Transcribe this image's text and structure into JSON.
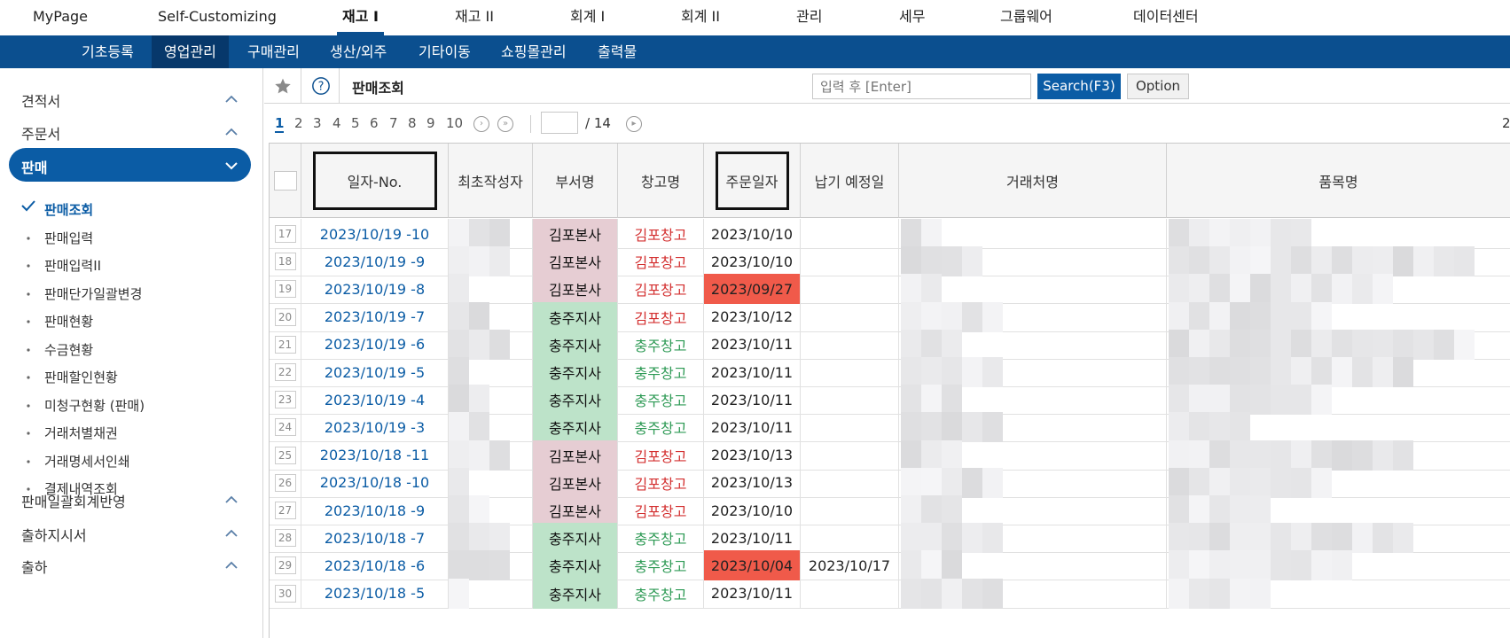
{
  "top_nav": {
    "items": [
      {
        "label": "MyPage"
      },
      {
        "label": "Self-Customizing"
      },
      {
        "label": "재고 I",
        "active": true
      },
      {
        "label": "재고 II"
      },
      {
        "label": "회계 I"
      },
      {
        "label": "회계 II"
      },
      {
        "label": "관리"
      },
      {
        "label": "세무"
      },
      {
        "label": "그룹웨어"
      },
      {
        "label": "데이터센터"
      }
    ]
  },
  "sub_nav": {
    "items": [
      {
        "label": "기초등록"
      },
      {
        "label": "영업관리",
        "active": true
      },
      {
        "label": "구매관리"
      },
      {
        "label": "생산/외주"
      },
      {
        "label": "기타이동"
      },
      {
        "label": "쇼핑몰관리"
      },
      {
        "label": "출력물"
      }
    ]
  },
  "sidebar": {
    "groups_top": [
      {
        "label": "견적서",
        "icon": "chevron-up-icon"
      },
      {
        "label": "주문서",
        "icon": "chevron-up-icon"
      },
      {
        "label": "판매",
        "icon": "chevron-down-icon",
        "active": true
      }
    ],
    "sub_items": [
      {
        "label": "판매조회",
        "active": true
      },
      {
        "label": "판매입력"
      },
      {
        "label": "판매입력II"
      },
      {
        "label": "판매단가일괄변경"
      },
      {
        "label": "판매현황"
      },
      {
        "label": "수금현황"
      },
      {
        "label": "판매할인현황"
      },
      {
        "label": "미청구현황 (판매)"
      },
      {
        "label": "거래처별채권"
      },
      {
        "label": "거래명세서인쇄"
      },
      {
        "label": "결제내역조회"
      }
    ],
    "groups_bottom": [
      {
        "label": "판매일괄회계반영",
        "icon": "chevron-up-icon"
      },
      {
        "label": "출하지시서",
        "icon": "chevron-up-icon"
      },
      {
        "label": "출하",
        "icon": "chevron-up-icon"
      }
    ]
  },
  "toolbar": {
    "page_title": "판매조회",
    "search_placeholder": "입력 후 [Enter]",
    "search_button": "Search(F3)",
    "option_button": "Option"
  },
  "pager": {
    "pages": [
      "1",
      "2",
      "3",
      "4",
      "5",
      "6",
      "7",
      "8",
      "9",
      "10"
    ],
    "current": "1",
    "total": "/ 14",
    "edge_text": "2"
  },
  "grid": {
    "columns": [
      {
        "key": "check",
        "label": ""
      },
      {
        "key": "date_no",
        "label": "일자-No.",
        "boxed": true
      },
      {
        "key": "creator",
        "label": "최초작성자"
      },
      {
        "key": "dept",
        "label": "부서명"
      },
      {
        "key": "warehouse",
        "label": "창고명"
      },
      {
        "key": "order_date",
        "label": "주문일자",
        "boxed": true
      },
      {
        "key": "due_date",
        "label": "납기 예정일"
      },
      {
        "key": "client",
        "label": "거래처명"
      },
      {
        "key": "item",
        "label": "품목명"
      }
    ],
    "rows": [
      {
        "n": "17",
        "date_no": "2023/10/19 -10",
        "dept": "김포본사",
        "warehouse": "김포창고",
        "order_date": "2023/10/10",
        "due_date": "",
        "alert": false
      },
      {
        "n": "18",
        "date_no": "2023/10/19 -9",
        "dept": "김포본사",
        "warehouse": "김포창고",
        "order_date": "2023/10/10",
        "due_date": "",
        "alert": false
      },
      {
        "n": "19",
        "date_no": "2023/10/19 -8",
        "dept": "김포본사",
        "warehouse": "김포창고",
        "order_date": "2023/09/27",
        "due_date": "",
        "alert": true
      },
      {
        "n": "20",
        "date_no": "2023/10/19 -7",
        "dept": "충주지사",
        "warehouse": "김포창고",
        "order_date": "2023/10/12",
        "due_date": "",
        "alert": false
      },
      {
        "n": "21",
        "date_no": "2023/10/19 -6",
        "dept": "충주지사",
        "warehouse": "충주창고",
        "order_date": "2023/10/11",
        "due_date": "",
        "alert": false
      },
      {
        "n": "22",
        "date_no": "2023/10/19 -5",
        "dept": "충주지사",
        "warehouse": "충주창고",
        "order_date": "2023/10/11",
        "due_date": "",
        "alert": false
      },
      {
        "n": "23",
        "date_no": "2023/10/19 -4",
        "dept": "충주지사",
        "warehouse": "충주창고",
        "order_date": "2023/10/11",
        "due_date": "",
        "alert": false
      },
      {
        "n": "24",
        "date_no": "2023/10/19 -3",
        "dept": "충주지사",
        "warehouse": "충주창고",
        "order_date": "2023/10/11",
        "due_date": "",
        "alert": false
      },
      {
        "n": "25",
        "date_no": "2023/10/18 -11",
        "dept": "김포본사",
        "warehouse": "김포창고",
        "order_date": "2023/10/13",
        "due_date": "",
        "alert": false
      },
      {
        "n": "26",
        "date_no": "2023/10/18 -10",
        "dept": "김포본사",
        "warehouse": "김포창고",
        "order_date": "2023/10/13",
        "due_date": "",
        "alert": false
      },
      {
        "n": "27",
        "date_no": "2023/10/18 -9",
        "dept": "김포본사",
        "warehouse": "김포창고",
        "order_date": "2023/10/10",
        "due_date": "",
        "alert": false
      },
      {
        "n": "28",
        "date_no": "2023/10/18 -7",
        "dept": "충주지사",
        "warehouse": "충주창고",
        "order_date": "2023/10/11",
        "due_date": "",
        "alert": false
      },
      {
        "n": "29",
        "date_no": "2023/10/18 -6",
        "dept": "충주지사",
        "warehouse": "충주창고",
        "order_date": "2023/10/04",
        "due_date": "2023/10/17",
        "alert": true
      },
      {
        "n": "30",
        "date_no": "2023/10/18 -5",
        "dept": "충주지사",
        "warehouse": "충주창고",
        "order_date": "2023/10/11",
        "due_date": "",
        "alert": false
      }
    ]
  },
  "colors": {
    "brand": "#0b4f8f",
    "active_group": "#0b5ca5",
    "dept_gimpo_bg": "#e6cdd3",
    "dept_chungju_bg": "#bde3c9",
    "warehouse_gimpo": "#d32f2f",
    "warehouse_chungju": "#2e9a55",
    "alert_bg": "#f05a4a"
  }
}
